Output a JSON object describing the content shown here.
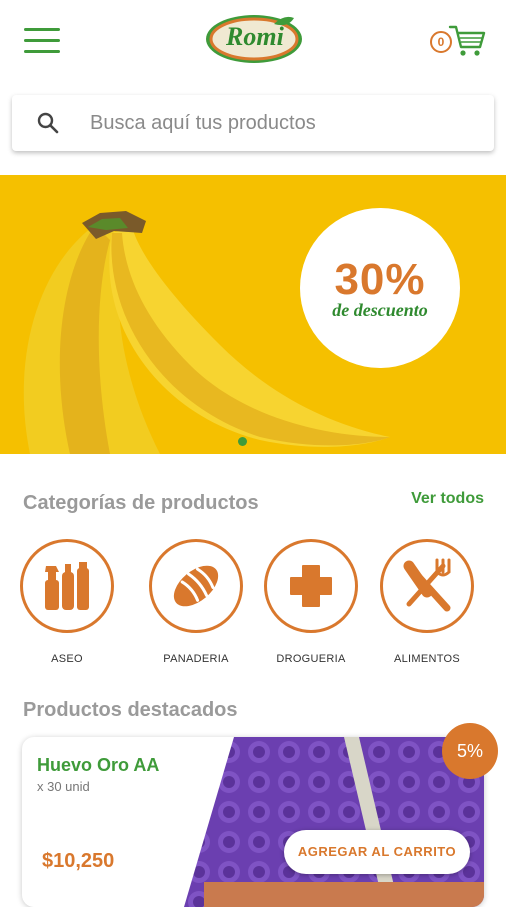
{
  "header": {
    "menu_icon": "hamburger-menu-icon",
    "logo_text": "Romi",
    "cart_icon": "shopping-cart-icon",
    "cart_count": "0"
  },
  "search": {
    "placeholder": "Busca aquí tus productos",
    "icon": "search-icon"
  },
  "banner": {
    "promo_value": "30%",
    "promo_text": "de descuento",
    "page_indicator": {
      "active": 1
    }
  },
  "categories": {
    "title": "Categorías de productos",
    "see_all": "Ver todos",
    "items": [
      {
        "label": "ASEO",
        "icon": "cleaning-products-icon"
      },
      {
        "label": "PANADERIA",
        "icon": "bread-icon"
      },
      {
        "label": "DROGUERIA",
        "icon": "plus-cross-icon"
      },
      {
        "label": "ALIMENTOS",
        "icon": "fork-knife-icon"
      }
    ]
  },
  "featured": {
    "title": "Productos destacados",
    "product": {
      "name": "Huevo Oro AA",
      "quantity": "x 30 unid",
      "price": "$10,250",
      "discount": "5%",
      "add_label": "AGREGAR AL CARRITO"
    }
  },
  "colors": {
    "green": "#3f9b3a",
    "orange": "#d9782d",
    "banner_yellow": "#f5c000"
  }
}
